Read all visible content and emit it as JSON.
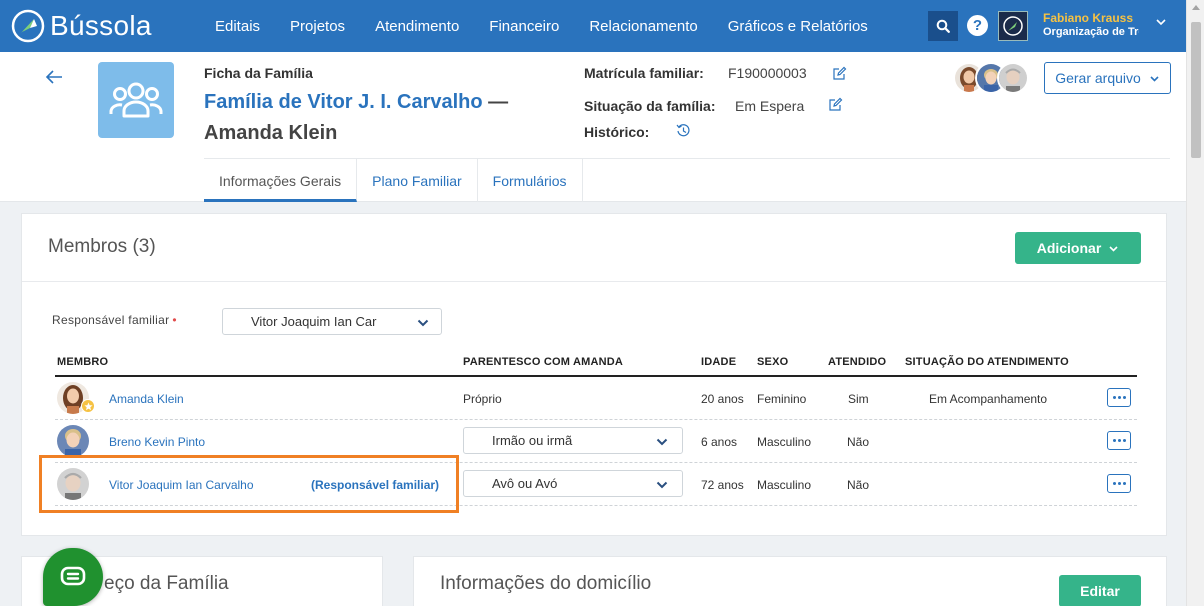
{
  "app": {
    "name": "Bússola",
    "brand_color": "#2a73bd",
    "accent_green": "#35b48a"
  },
  "nav": {
    "items": [
      "Editais",
      "Projetos",
      "Atendimento",
      "Financeiro",
      "Relacionamento",
      "Gráficos e Relatórios"
    ]
  },
  "user": {
    "name": "Fabiano Krauss",
    "org": "Organização de Tre"
  },
  "header": {
    "ficha_label": "Ficha da Família",
    "title_link": "Família de Vitor J. I. Carvalho",
    "title_dash": " — ",
    "title_rest": "Amanda Klein",
    "matricula_label": "Matrícula familiar:",
    "matricula_value": "F190000003",
    "situacao_label": "Situação da família:",
    "situacao_value": "Em Espera",
    "historico_label": "Histórico:",
    "gerar_label": "Gerar arquivo"
  },
  "tabs": [
    "Informações Gerais",
    "Plano Familiar",
    "Formulários"
  ],
  "members": {
    "title": "Membros (3)",
    "add_label": "Adicionar",
    "resp_label": "Responsável familiar",
    "resp_required": "•",
    "resp_value": "Vitor Joaquim Ian Car",
    "columns": [
      "MEMBRO",
      "PARENTESCO COM AMANDA",
      "IDADE",
      "SEXO",
      "ATENDIDO",
      "SITUAÇÃO DO ATENDIMENTO"
    ],
    "rows": [
      {
        "name": "Amanda Klein",
        "tag": "",
        "parentesco": "Próprio",
        "idade": "20 anos",
        "sexo": "Feminino",
        "atendido": "Sim",
        "situacao": "Em Acompanhamento"
      },
      {
        "name": "Breno Kevin Pinto",
        "tag": "",
        "parentesco": "Irmão ou irmã",
        "idade": "6 anos",
        "sexo": "Masculino",
        "atendido": "Não",
        "situacao": ""
      },
      {
        "name": "Vitor Joaquim Ian Carvalho",
        "tag": "(Responsável familiar)",
        "parentesco": "Avô ou Avó",
        "idade": "72 anos",
        "sexo": "Masculino",
        "atendido": "Não",
        "situacao": ""
      }
    ]
  },
  "bottom": {
    "address_title": "eço da Família",
    "domicilio_title": "Informações do domicílio",
    "edit_label": "Editar"
  },
  "icons": {
    "search": "search-icon",
    "help": "help-icon",
    "back": "arrow-left-icon",
    "edit": "edit-icon",
    "history": "history-icon",
    "chat": "chat-icon",
    "more": "more-icon",
    "chevron": "chevron-down-icon"
  }
}
